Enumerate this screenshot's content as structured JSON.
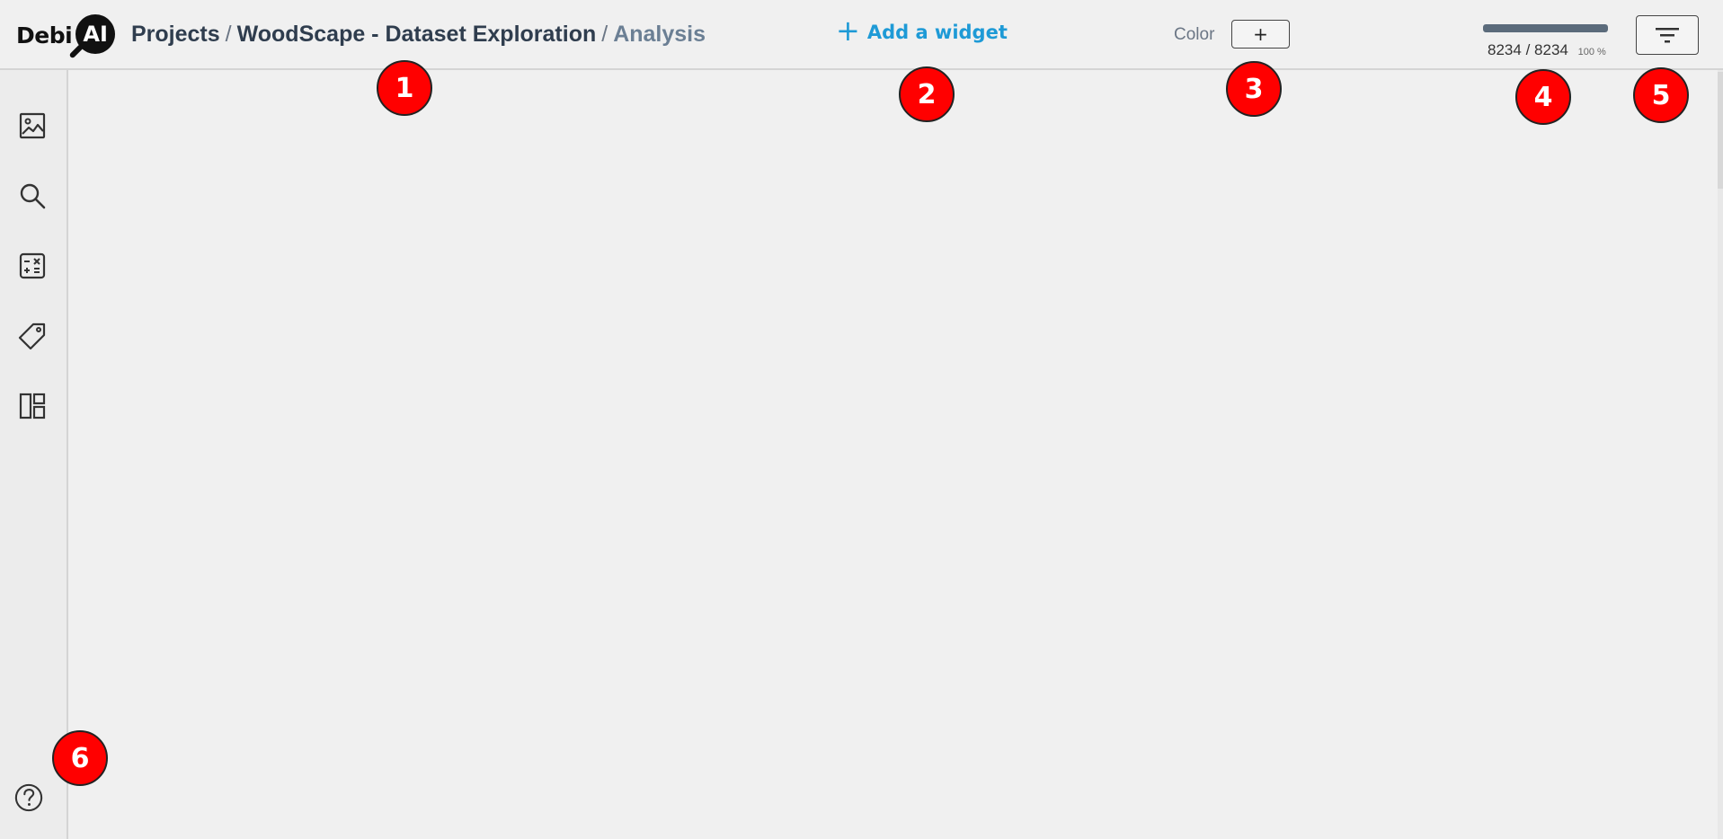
{
  "logo": {
    "text": "Debi",
    "badge": "AI"
  },
  "breadcrumb": {
    "projects": "Projects",
    "sep1": "/",
    "project": "WoodScape - Dataset Exploration",
    "sep2": "/",
    "current": "Analysis"
  },
  "toolbar": {
    "add_widget_icon": "+",
    "add_widget_label": "Add a widget",
    "color_label": "Color",
    "color_button": "+"
  },
  "samples": {
    "selected": "8234",
    "separator": "/",
    "total": "8234",
    "percent_label": "100 %",
    "fill_fraction": 1.0
  },
  "sidebar": {
    "items": [
      {
        "icon": "image-icon"
      },
      {
        "icon": "search-icon"
      },
      {
        "icon": "calculator-icon"
      },
      {
        "icon": "tag-icon"
      },
      {
        "icon": "layout-icon"
      }
    ],
    "help_icon": "help-icon"
  },
  "markers": [
    "1",
    "2",
    "3",
    "4",
    "5",
    "6"
  ],
  "colors": {
    "accent": "#1e9ad6",
    "marker": "#ff0000",
    "progress": "#5b6b7b",
    "breadcrumb": "#2f3d4e"
  }
}
